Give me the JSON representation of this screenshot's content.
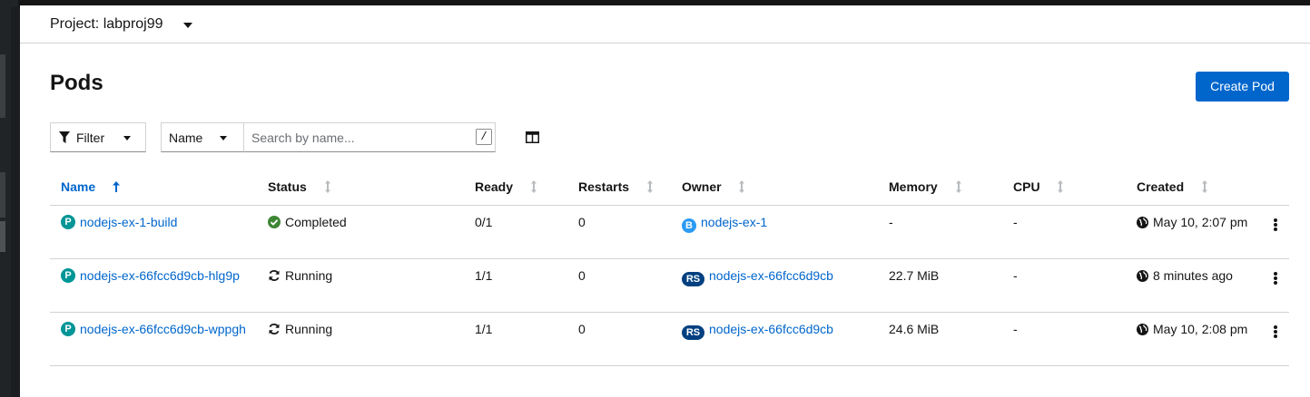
{
  "project": {
    "label": "Project: labproj99"
  },
  "page": {
    "title": "Pods",
    "create_label": "Create Pod"
  },
  "toolbar": {
    "filter_label": "Filter",
    "name_label": "Name",
    "search_placeholder": "Search by name...",
    "search_value": "",
    "shortcut_key": "/"
  },
  "table": {
    "headers": {
      "name": "Name",
      "status": "Status",
      "ready": "Ready",
      "restarts": "Restarts",
      "owner": "Owner",
      "memory": "Memory",
      "cpu": "CPU",
      "created": "Created"
    },
    "sort": {
      "column": "Name",
      "direction": "ascending"
    },
    "rows": [
      {
        "resource_badge": "P",
        "name": "nodejs-ex-1-build",
        "status": "Completed",
        "status_icon": "check-circle-icon",
        "status_color": "#3e8635",
        "ready": "0/1",
        "restarts": "0",
        "owner_badge": "B",
        "owner": "nodejs-ex-1",
        "memory": "-",
        "cpu": "-",
        "created": "May 10, 2:07 pm"
      },
      {
        "resource_badge": "P",
        "name": "nodejs-ex-66fcc6d9cb-hlg9p",
        "status": "Running",
        "status_icon": "sync-icon",
        "ready": "1/1",
        "restarts": "0",
        "owner_badge": "RS",
        "owner": "nodejs-ex-66fcc6d9cb",
        "memory": "22.7 MiB",
        "cpu": "-",
        "created": "8 minutes ago"
      },
      {
        "resource_badge": "P",
        "name": "nodejs-ex-66fcc6d9cb-wppgh",
        "status": "Running",
        "status_icon": "sync-icon",
        "ready": "1/1",
        "restarts": "0",
        "owner_badge": "RS",
        "owner": "nodejs-ex-66fcc6d9cb",
        "memory": "24.6 MiB",
        "cpu": "-",
        "created": "May 10, 2:08 pm"
      }
    ]
  },
  "colors": {
    "primary": "#0066cc",
    "pod_badge": "#009596",
    "build_badge": "#2b9af3",
    "rs_badge": "#004080"
  }
}
